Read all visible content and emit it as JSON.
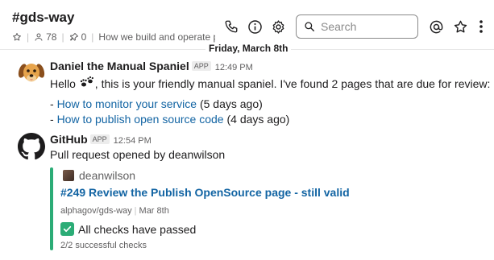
{
  "header": {
    "channel_name": "#gds-way",
    "member_count": "78",
    "pinned_count": "0",
    "topic": "How we build and operate pr",
    "search_placeholder": "Search"
  },
  "date_divider": "Friday, March 8th",
  "messages": [
    {
      "sender": "Daniel the Manual Spaniel",
      "badge": "APP",
      "time": "12:49 PM",
      "text_prefix": "Hello",
      "text_suffix": ", this is your friendly manual spaniel. I've found 2 pages that are due for review:",
      "items": [
        {
          "prefix": "- ",
          "link": "How to monitor your service",
          "suffix": " (5 days ago)"
        },
        {
          "prefix": "- ",
          "link": "How to publish open source code",
          "suffix": " (4 days ago)"
        }
      ]
    },
    {
      "sender": "GitHub",
      "badge": "APP",
      "time": "12:54 PM",
      "text": "Pull request opened by deanwilson",
      "attachment": {
        "author": "deanwilson",
        "title": "#249 Review the Publish OpenSource page - still valid",
        "repo": "alphagov/gds-way",
        "date": "Mar 8th",
        "status": "All checks have passed",
        "status_detail": "2/2 successful checks"
      }
    }
  ],
  "icons": [
    "star-icon",
    "members-icon",
    "pin-icon",
    "phone-icon",
    "info-icon",
    "gear-icon",
    "search-icon",
    "at-sign-icon",
    "star-outline-icon",
    "more-vertical-icon",
    "dog-avatar-icon",
    "paws-emoji-icon",
    "github-logo-icon",
    "check-mark-icon"
  ],
  "colors": {
    "link": "#1264a3",
    "accent_green": "#2bac76",
    "muted_text": "#616061"
  }
}
